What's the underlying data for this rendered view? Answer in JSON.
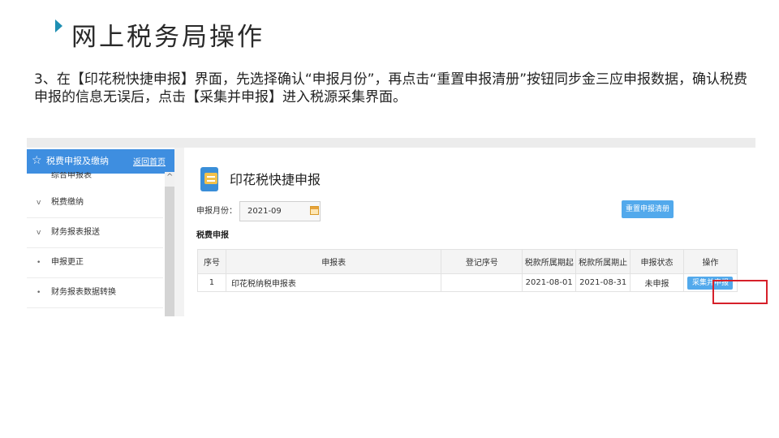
{
  "slide": {
    "title": "网上税务局操作",
    "instruction": "3、在【印花税快捷申报】界面，先选择确认“申报月份”，再点击“重置申报清册”按钮同步金三应申报数据，确认税费申报的信息无误后，点击【采集并申报】进入税源采集界面。"
  },
  "sidebar": {
    "header_title": "税费申报及缴纳",
    "home_link": "返回首页",
    "partial_item": "综合申报表",
    "items": [
      {
        "mark": "v",
        "label": "税费缴纳"
      },
      {
        "mark": "v",
        "label": "财务报表报送"
      },
      {
        "mark": "•",
        "label": "申报更正"
      },
      {
        "mark": "•",
        "label": "财务报表数据转换"
      }
    ]
  },
  "main": {
    "page_title": "印花税快捷申报",
    "month_label": "申报月份：",
    "month_value": "2021-09",
    "reset_button": "重置申报清册",
    "section_title": "税费申报",
    "table": {
      "headers": [
        "序号",
        "申报表",
        "登记序号",
        "税款所属期起",
        "税款所属期止",
        "申报状态",
        "操作"
      ],
      "rows": [
        {
          "index": "1",
          "form": "印花税纳税申报表",
          "reg_no": "",
          "period_start": "2021-08-01",
          "period_end": "2021-08-31",
          "status": "未申报",
          "action": "采集并申报"
        }
      ]
    }
  },
  "colors": {
    "accent": "#3e8ee0",
    "button": "#52a9ec",
    "highlight": "#d6202a",
    "title_marker": "#1f8fb3"
  },
  "icons": [
    "play-marker-icon",
    "star-icon",
    "form-page-icon",
    "calendar-icon",
    "scroll-up-icon"
  ]
}
